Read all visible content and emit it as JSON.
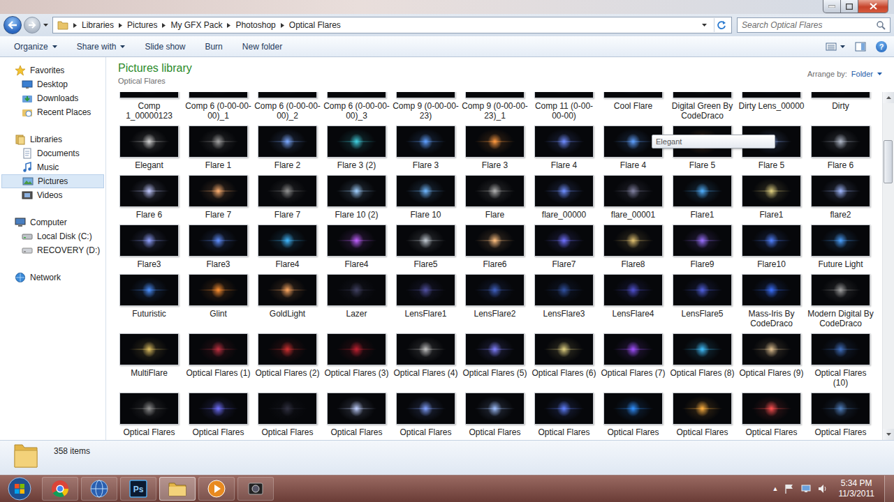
{
  "address": {
    "crumbs": [
      "Libraries",
      "Pictures",
      "My GFX Pack",
      "Photoshop",
      "Optical Flares"
    ]
  },
  "search": {
    "placeholder": "Search Optical Flares"
  },
  "toolbar": {
    "buttons": [
      {
        "label": "Organize",
        "dropdown": true
      },
      {
        "label": "Share with",
        "dropdown": true
      },
      {
        "label": "Slide show",
        "dropdown": false
      },
      {
        "label": "Burn",
        "dropdown": false
      },
      {
        "label": "New folder",
        "dropdown": false
      }
    ],
    "help": "?"
  },
  "sidebar": {
    "groups": [
      {
        "label": "Favorites",
        "items": [
          {
            "label": "Desktop",
            "selected": false
          },
          {
            "label": "Downloads",
            "selected": false
          },
          {
            "label": "Recent Places",
            "selected": false
          }
        ]
      },
      {
        "label": "Libraries",
        "items": [
          {
            "label": "Documents",
            "selected": false
          },
          {
            "label": "Music",
            "selected": false
          },
          {
            "label": "Pictures",
            "selected": true
          },
          {
            "label": "Videos",
            "selected": false
          }
        ]
      },
      {
        "label": "Computer",
        "items": [
          {
            "label": "Local Disk (C:)",
            "selected": false
          },
          {
            "label": "RECOVERY (D:)",
            "selected": false
          }
        ]
      },
      {
        "label": "Network",
        "items": []
      }
    ]
  },
  "library": {
    "title": "Pictures library",
    "subtitle": "Optical Flares",
    "arrange_label": "Arrange by:",
    "arrange_value": "Folder"
  },
  "files": [
    {
      "name": "Comp 1_00000123",
      "color": "#6a7a90"
    },
    {
      "name": "Comp 6 (0-00-00-00)_1",
      "color": "#6a6a80"
    },
    {
      "name": "Comp 6 (0-00-00-00)_2",
      "color": "#6a6a80"
    },
    {
      "name": "Comp 6 (0-00-00-00)_3",
      "color": "#6a6a80"
    },
    {
      "name": "Comp 9 (0-00-00-23)",
      "color": "#707070"
    },
    {
      "name": "Comp 9 (0-00-00-23)_1",
      "color": "#707070"
    },
    {
      "name": "Comp 11 (0-00-00-00)",
      "color": "#707070"
    },
    {
      "name": "Cool Flare",
      "color": "#6080c0"
    },
    {
      "name": "Digital Green By CodeDraco",
      "color": "#50a060"
    },
    {
      "name": "Dirty Lens_00000",
      "color": "#3a5a90"
    },
    {
      "name": "Dirty",
      "color": "#807060"
    },
    {
      "name": "Elegant",
      "color": "#d0d0d0"
    },
    {
      "name": "Flare 1",
      "color": "#a0a0a0"
    },
    {
      "name": "Flare 2",
      "color": "#7aa8ff"
    },
    {
      "name": "Flare 3 (2)",
      "color": "#40d0e0"
    },
    {
      "name": "Flare 3",
      "color": "#5fa0ff"
    },
    {
      "name": "Flare 3",
      "color": "#ff9a40"
    },
    {
      "name": "Flare 4",
      "color": "#6f8cff"
    },
    {
      "name": "Flare 4",
      "color": "#5fa0ff"
    },
    {
      "name": "Flare 5",
      "color": "#ffa050"
    },
    {
      "name": "Flare 5",
      "color": "#8fb0ff"
    },
    {
      "name": "Flare 6",
      "color": "#b0b8c8"
    },
    {
      "name": "Flare 6",
      "color": "#c0c8ff"
    },
    {
      "name": "Flare 7",
      "color": "#ffb070"
    },
    {
      "name": "Flare 7",
      "color": "#909090"
    },
    {
      "name": "Flare 10 (2)",
      "color": "#a0d0ff"
    },
    {
      "name": "Flare 10",
      "color": "#70b8ff"
    },
    {
      "name": "Flare",
      "color": "#b0b0b0"
    },
    {
      "name": "flare_00000",
      "color": "#6f8fff"
    },
    {
      "name": "flare_00001",
      "color": "#8080a0"
    },
    {
      "name": "Flare1",
      "color": "#50b0ff"
    },
    {
      "name": "Flare1",
      "color": "#e0d080"
    },
    {
      "name": "flare2",
      "color": "#a0b8ff"
    },
    {
      "name": "Flare3",
      "color": "#8fa0ff"
    },
    {
      "name": "Flare3",
      "color": "#5f8fff"
    },
    {
      "name": "Flare4",
      "color": "#40b8ff"
    },
    {
      "name": "Flare4",
      "color": "#c060ff"
    },
    {
      "name": "Flare5",
      "color": "#c0c8d0"
    },
    {
      "name": "Flare6",
      "color": "#ffc080"
    },
    {
      "name": "Flare7",
      "color": "#7070ff"
    },
    {
      "name": "Flare8",
      "color": "#e0c070"
    },
    {
      "name": "Flare9",
      "color": "#9a70ff"
    },
    {
      "name": "Flare10",
      "color": "#5080ff"
    },
    {
      "name": "Future Light",
      "color": "#4aa0ff"
    },
    {
      "name": "Futuristic",
      "color": "#4a90ff"
    },
    {
      "name": "Glint",
      "color": "#ff9030"
    },
    {
      "name": "GoldLight",
      "color": "#ffa860"
    },
    {
      "name": "Lazer",
      "color": "#404060"
    },
    {
      "name": "LensFlare1",
      "color": "#5050a0"
    },
    {
      "name": "LensFlare2",
      "color": "#4060c0"
    },
    {
      "name": "LensFlare3",
      "color": "#3050a0"
    },
    {
      "name": "LensFlare4",
      "color": "#5050d0"
    },
    {
      "name": "LensFlare5",
      "color": "#5060e0"
    },
    {
      "name": "Mass-Iris By CodeDraco",
      "color": "#3a70ff"
    },
    {
      "name": "Modern Digital By CodeDraco",
      "color": "#a0a0a0"
    },
    {
      "name": "MultiFlare",
      "color": "#e0c060"
    },
    {
      "name": "Optical Flares (1)",
      "color": "#c03040"
    },
    {
      "name": "Optical Flares (2)",
      "color": "#d03030"
    },
    {
      "name": "Optical Flares (3)",
      "color": "#c02030"
    },
    {
      "name": "Optical Flares (4)",
      "color": "#c0c0c0"
    },
    {
      "name": "Optical Flares (5)",
      "color": "#8080ff"
    },
    {
      "name": "Optical Flares (6)",
      "color": "#e0d080"
    },
    {
      "name": "Optical Flares (7)",
      "color": "#a050ff"
    },
    {
      "name": "Optical Flares (8)",
      "color": "#40c0ff"
    },
    {
      "name": "Optical Flares (9)",
      "color": "#e0c090"
    },
    {
      "name": "Optical Flares (10)",
      "color": "#4070c0"
    },
    {
      "name": "Optical Flares",
      "color": "#909090"
    },
    {
      "name": "Optical Flares",
      "color": "#7070ff"
    },
    {
      "name": "Optical Flares",
      "color": "#303040"
    },
    {
      "name": "Optical Flares",
      "color": "#c0d0ff"
    },
    {
      "name": "Optical Flares",
      "color": "#80a0ff"
    },
    {
      "name": "Optical Flares",
      "color": "#a0c0ff"
    },
    {
      "name": "Optical Flares",
      "color": "#6080ff"
    },
    {
      "name": "Optical Flares",
      "color": "#3090ff"
    },
    {
      "name": "Optical Flares",
      "color": "#ffb040"
    },
    {
      "name": "Optical Flares",
      "color": "#ff5050"
    },
    {
      "name": "Optical Flares",
      "color": "#5080c0"
    }
  ],
  "tooltip": "Elegant",
  "scrollbar": {
    "level": 0.13
  },
  "status_bar": {
    "count": "358 items"
  },
  "taskbar": {
    "apps": [
      {
        "selected": false
      },
      {
        "selected": false
      },
      {
        "selected": false
      },
      {
        "selected": true
      },
      {
        "selected": false
      },
      {
        "selected": false
      }
    ],
    "photoshop_label": "Ps",
    "tray_arrow": "▲",
    "time": "5:34 PM",
    "date": "11/3/2011"
  }
}
